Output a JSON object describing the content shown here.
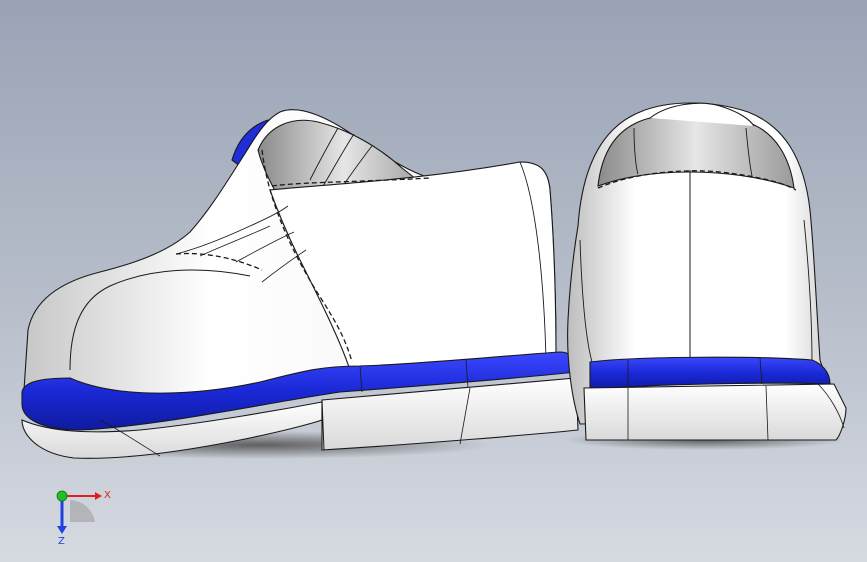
{
  "viewport": {
    "background_top": "#9aa4b6",
    "background_bottom": "#d4d8e0"
  },
  "model": {
    "shoe_body_color": "#ffffff",
    "shoe_shadow_color": "#c9c9c9",
    "welt_color": "#1f2ed8",
    "outline_color": "#1a1a1a"
  },
  "triad": {
    "x_label": "X",
    "z_label": "Z",
    "x_color": "#e02020",
    "y_color": "#20c020",
    "z_color": "#2040e0"
  }
}
